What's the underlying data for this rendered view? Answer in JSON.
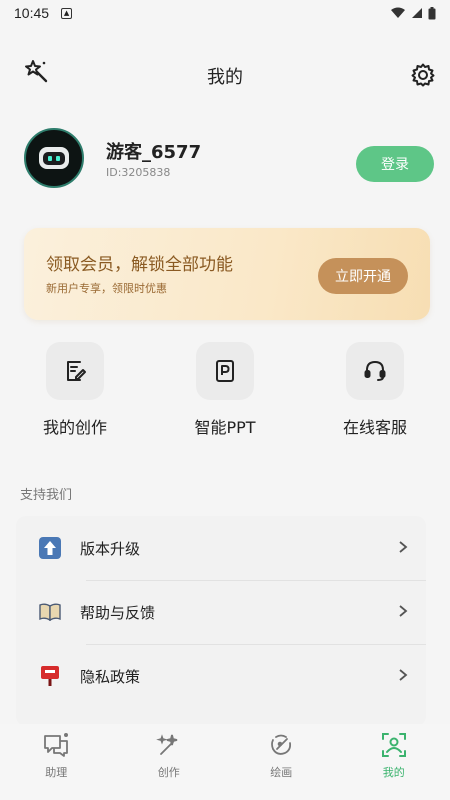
{
  "status_bar": {
    "time": "10:45"
  },
  "header": {
    "title": "我的"
  },
  "profile": {
    "username": "游客_6577",
    "user_id": "ID:3205838",
    "login_label": "登录"
  },
  "membership": {
    "title": "领取会员，解锁全部功能",
    "subtitle": "新用户专享，领限时优惠",
    "button_label": "立即开通"
  },
  "features": [
    {
      "label": "我的创作",
      "icon": "edit-document-icon"
    },
    {
      "label": "智能PPT",
      "icon": "ppt-icon"
    },
    {
      "label": "在线客服",
      "icon": "headset-icon"
    }
  ],
  "support": {
    "section_title": "支持我们",
    "items": [
      {
        "label": "版本升级",
        "icon": "up-arrow-icon"
      },
      {
        "label": "帮助与反馈",
        "icon": "book-icon"
      },
      {
        "label": "隐私政策",
        "icon": "postbox-icon"
      }
    ]
  },
  "nav": {
    "items": [
      {
        "label": "助理",
        "icon": "chat-icon"
      },
      {
        "label": "创作",
        "icon": "magic-wand-icon"
      },
      {
        "label": "绘画",
        "icon": "paint-icon"
      },
      {
        "label": "我的",
        "icon": "profile-icon"
      }
    ],
    "active_index": 3
  },
  "colors": {
    "accent": "#5ec687",
    "active_nav": "#3bb36e",
    "vip_button": "#c5915a",
    "vip_text": "#8a5a22"
  }
}
